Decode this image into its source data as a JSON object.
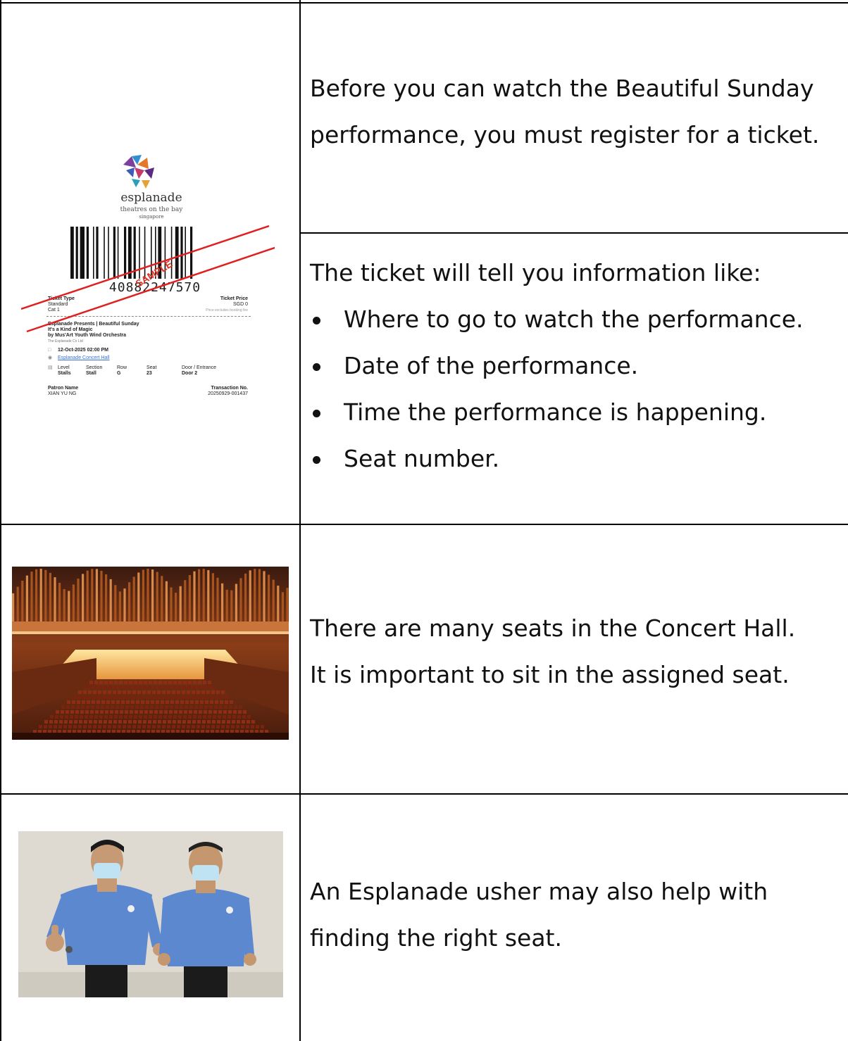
{
  "rows": [
    {
      "text": "Before you can watch the Beautiful Sunday performance, you must register for a ticket."
    },
    {
      "intro": "The ticket will tell you information like:",
      "bullets": [
        "Where to go to watch the performance.",
        "Date of the performance.",
        "Time the performance is happening.",
        "Seat number."
      ]
    },
    {
      "line1": "There are many seats in the Concert Hall.",
      "line2": "It is important to sit in the assigned seat."
    },
    {
      "text": "An Esplanade usher may also help with finding the right seat."
    }
  ],
  "ticket": {
    "logo_word": "esplanade",
    "logo_sub1": "theatres on the bay",
    "logo_sub2": "singapore",
    "barcode_number": "40882247570",
    "watermark": "SAMPLE",
    "ticket_type_label": "Ticket Type",
    "ticket_type_value1": "Standard",
    "ticket_type_value2": "Cat 1",
    "ticket_price_label": "Ticket Price",
    "ticket_price_value": "SGD 0",
    "ticket_price_note": "Price excludes booking fee",
    "event_line1": "Esplanade Presents | Beautiful Sunday",
    "event_line2": "It's a Kind of Magic",
    "event_line3": "by Mus'Art Youth Wind Orchestra",
    "event_line4": "The Esplanade Co Ltd",
    "date_time": "12-Oct-2025 02:00 PM",
    "venue": "Esplanade Concert Hall",
    "level_label": "Level",
    "level_value": "Stalls",
    "section_label": "Section",
    "section_value": "Stall",
    "row_label": "Row",
    "row_value": "G",
    "seat_label": "Seat",
    "seat_value": "23",
    "door_label": "Door / Entrance",
    "door_value": "Door 2",
    "patron_label": "Patron Name",
    "patron_value": "XIAN YU NG",
    "transaction_label": "Transaction No.",
    "transaction_value": "20250929-001437"
  },
  "colors": {
    "border": "#000000",
    "text": "#111111",
    "strike": "#e02020",
    "hall_wood": "#b5501e",
    "usher_shirt": "#5b88cf"
  }
}
